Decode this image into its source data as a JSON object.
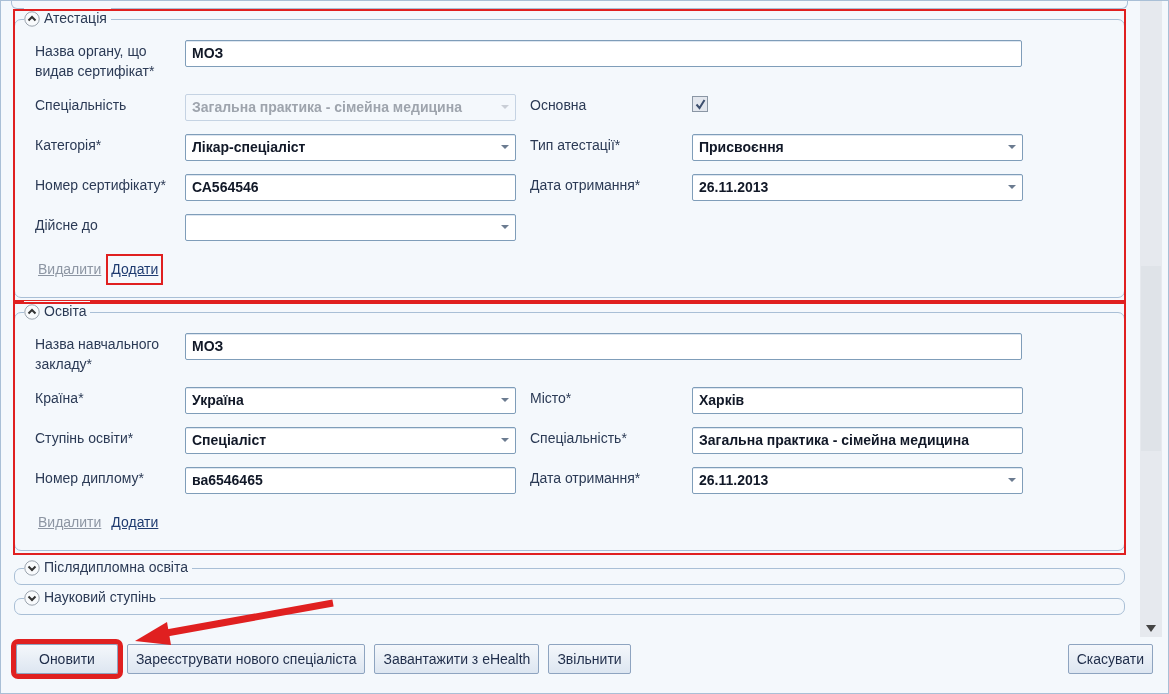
{
  "sections": [
    {
      "title": "Атестація",
      "expanded": true,
      "highlighted": true,
      "rows": [
        {
          "fields": [
            {
              "label": "Назва органу, що видав сертифікат*",
              "kind": "text",
              "value": "МОЗ",
              "wide": true
            }
          ]
        },
        {
          "fields": [
            {
              "label": "Спеціальність",
              "kind": "combo",
              "value": "Загальна практика - сімейна медицина",
              "disabled": true
            },
            {
              "label": "Основна",
              "kind": "checkbox",
              "checked": true
            }
          ]
        },
        {
          "fields": [
            {
              "label": "Категорія*",
              "kind": "combo",
              "value": "Лікар-спеціаліст"
            },
            {
              "label": "Тип атестації*",
              "kind": "combo",
              "value": "Присвоєння"
            }
          ]
        },
        {
          "fields": [
            {
              "label": "Номер сертифікату*",
              "kind": "text",
              "value": "СА564546"
            },
            {
              "label": "Дата отримання*",
              "kind": "combo",
              "value": "26.11.2013"
            }
          ]
        },
        {
          "fields": [
            {
              "label": "Дійсне до",
              "kind": "combo"
            }
          ]
        }
      ],
      "links": [
        {
          "label": "Видалити",
          "disabled": true,
          "highlighted": false
        },
        {
          "label": "Додати",
          "disabled": false,
          "highlighted": true
        }
      ]
    },
    {
      "title": "Освіта",
      "expanded": true,
      "highlighted": true,
      "rows": [
        {
          "fields": [
            {
              "label": "Назва навчального закладу*",
              "kind": "text",
              "value": "МОЗ",
              "wide": true
            }
          ]
        },
        {
          "fields": [
            {
              "label": "Країна*",
              "kind": "combo",
              "value": "Україна"
            },
            {
              "label": "Місто*",
              "kind": "text",
              "value": "Харків"
            }
          ]
        },
        {
          "fields": [
            {
              "label": "Ступінь освіти*",
              "kind": "combo",
              "value": "Спеціаліст"
            },
            {
              "label": "Спеціальність*",
              "kind": "text",
              "value": "Загальна практика - сімейна медицина"
            }
          ]
        },
        {
          "fields": [
            {
              "label": "Номер диплому*",
              "kind": "text",
              "value": "ва6546465"
            },
            {
              "label": "Дата отримання*",
              "kind": "combo",
              "value": "26.11.2013"
            }
          ]
        }
      ],
      "links": [
        {
          "label": "Видалити",
          "disabled": true,
          "highlighted": false
        },
        {
          "label": "Додати",
          "disabled": false,
          "highlighted": false
        }
      ]
    },
    {
      "title": "Післядипломна освіта",
      "expanded": false,
      "highlighted": false
    },
    {
      "title": "Науковий ступінь",
      "expanded": false,
      "highlighted": false
    }
  ],
  "left_buttons": [
    {
      "label": "Оновити",
      "highlighted": true
    },
    {
      "label": "Зареєструвати нового спеціаліста",
      "highlighted": false
    },
    {
      "label": "Завантажити з eHealth",
      "highlighted": false
    },
    {
      "label": "Звільнити",
      "highlighted": false
    }
  ],
  "right_buttons": [
    {
      "label": "Скасувати",
      "highlighted": false
    }
  ]
}
